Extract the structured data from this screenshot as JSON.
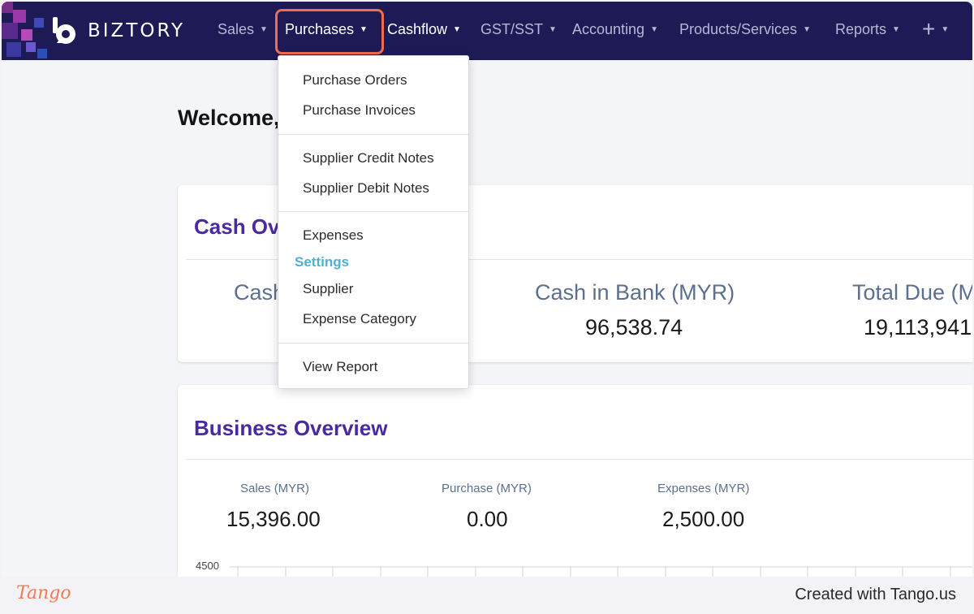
{
  "navbar": {
    "brand": "BIZTORY",
    "items": [
      {
        "label": "Sales"
      },
      {
        "label": "Purchases"
      },
      {
        "label": "Cashflow"
      },
      {
        "label": "GST/SST"
      },
      {
        "label": "Accounting"
      },
      {
        "label": "Products/Services"
      },
      {
        "label": "Reports"
      },
      {
        "label": "+"
      }
    ],
    "caret": "▼",
    "colors": {
      "bg": "#1e1a55",
      "highlight": "#f26b4a"
    }
  },
  "purchases_menu": {
    "items": [
      {
        "label": "Purchase Orders"
      },
      {
        "label": "Purchase Invoices"
      },
      {
        "label": "Supplier Credit Notes"
      },
      {
        "label": "Supplier Debit Notes"
      },
      {
        "label": "Expenses"
      },
      {
        "label": "Supplier"
      },
      {
        "label": "Expense Category"
      },
      {
        "label": "View Report"
      }
    ],
    "settings_header": "Settings"
  },
  "main": {
    "welcome": "Welcome,",
    "cash_overview": {
      "title": "Cash Ov",
      "metrics": [
        {
          "label": "Cash",
          "value": ""
        },
        {
          "label": "Cash in Bank (MYR)",
          "value": "96,538.74"
        },
        {
          "label": "Total Due (M",
          "value": "19,113,941"
        }
      ]
    },
    "business_overview": {
      "title": "Business Overview",
      "metrics": [
        {
          "label": "Sales (MYR)",
          "value": "15,396.00"
        },
        {
          "label": "Purchase (MYR)",
          "value": "0.00"
        },
        {
          "label": "Expenses (MYR)",
          "value": "2,500.00"
        }
      ],
      "chart_axis_top": "4500"
    }
  },
  "footer": {
    "logo": "Tango",
    "text": "Created with Tango.us"
  }
}
